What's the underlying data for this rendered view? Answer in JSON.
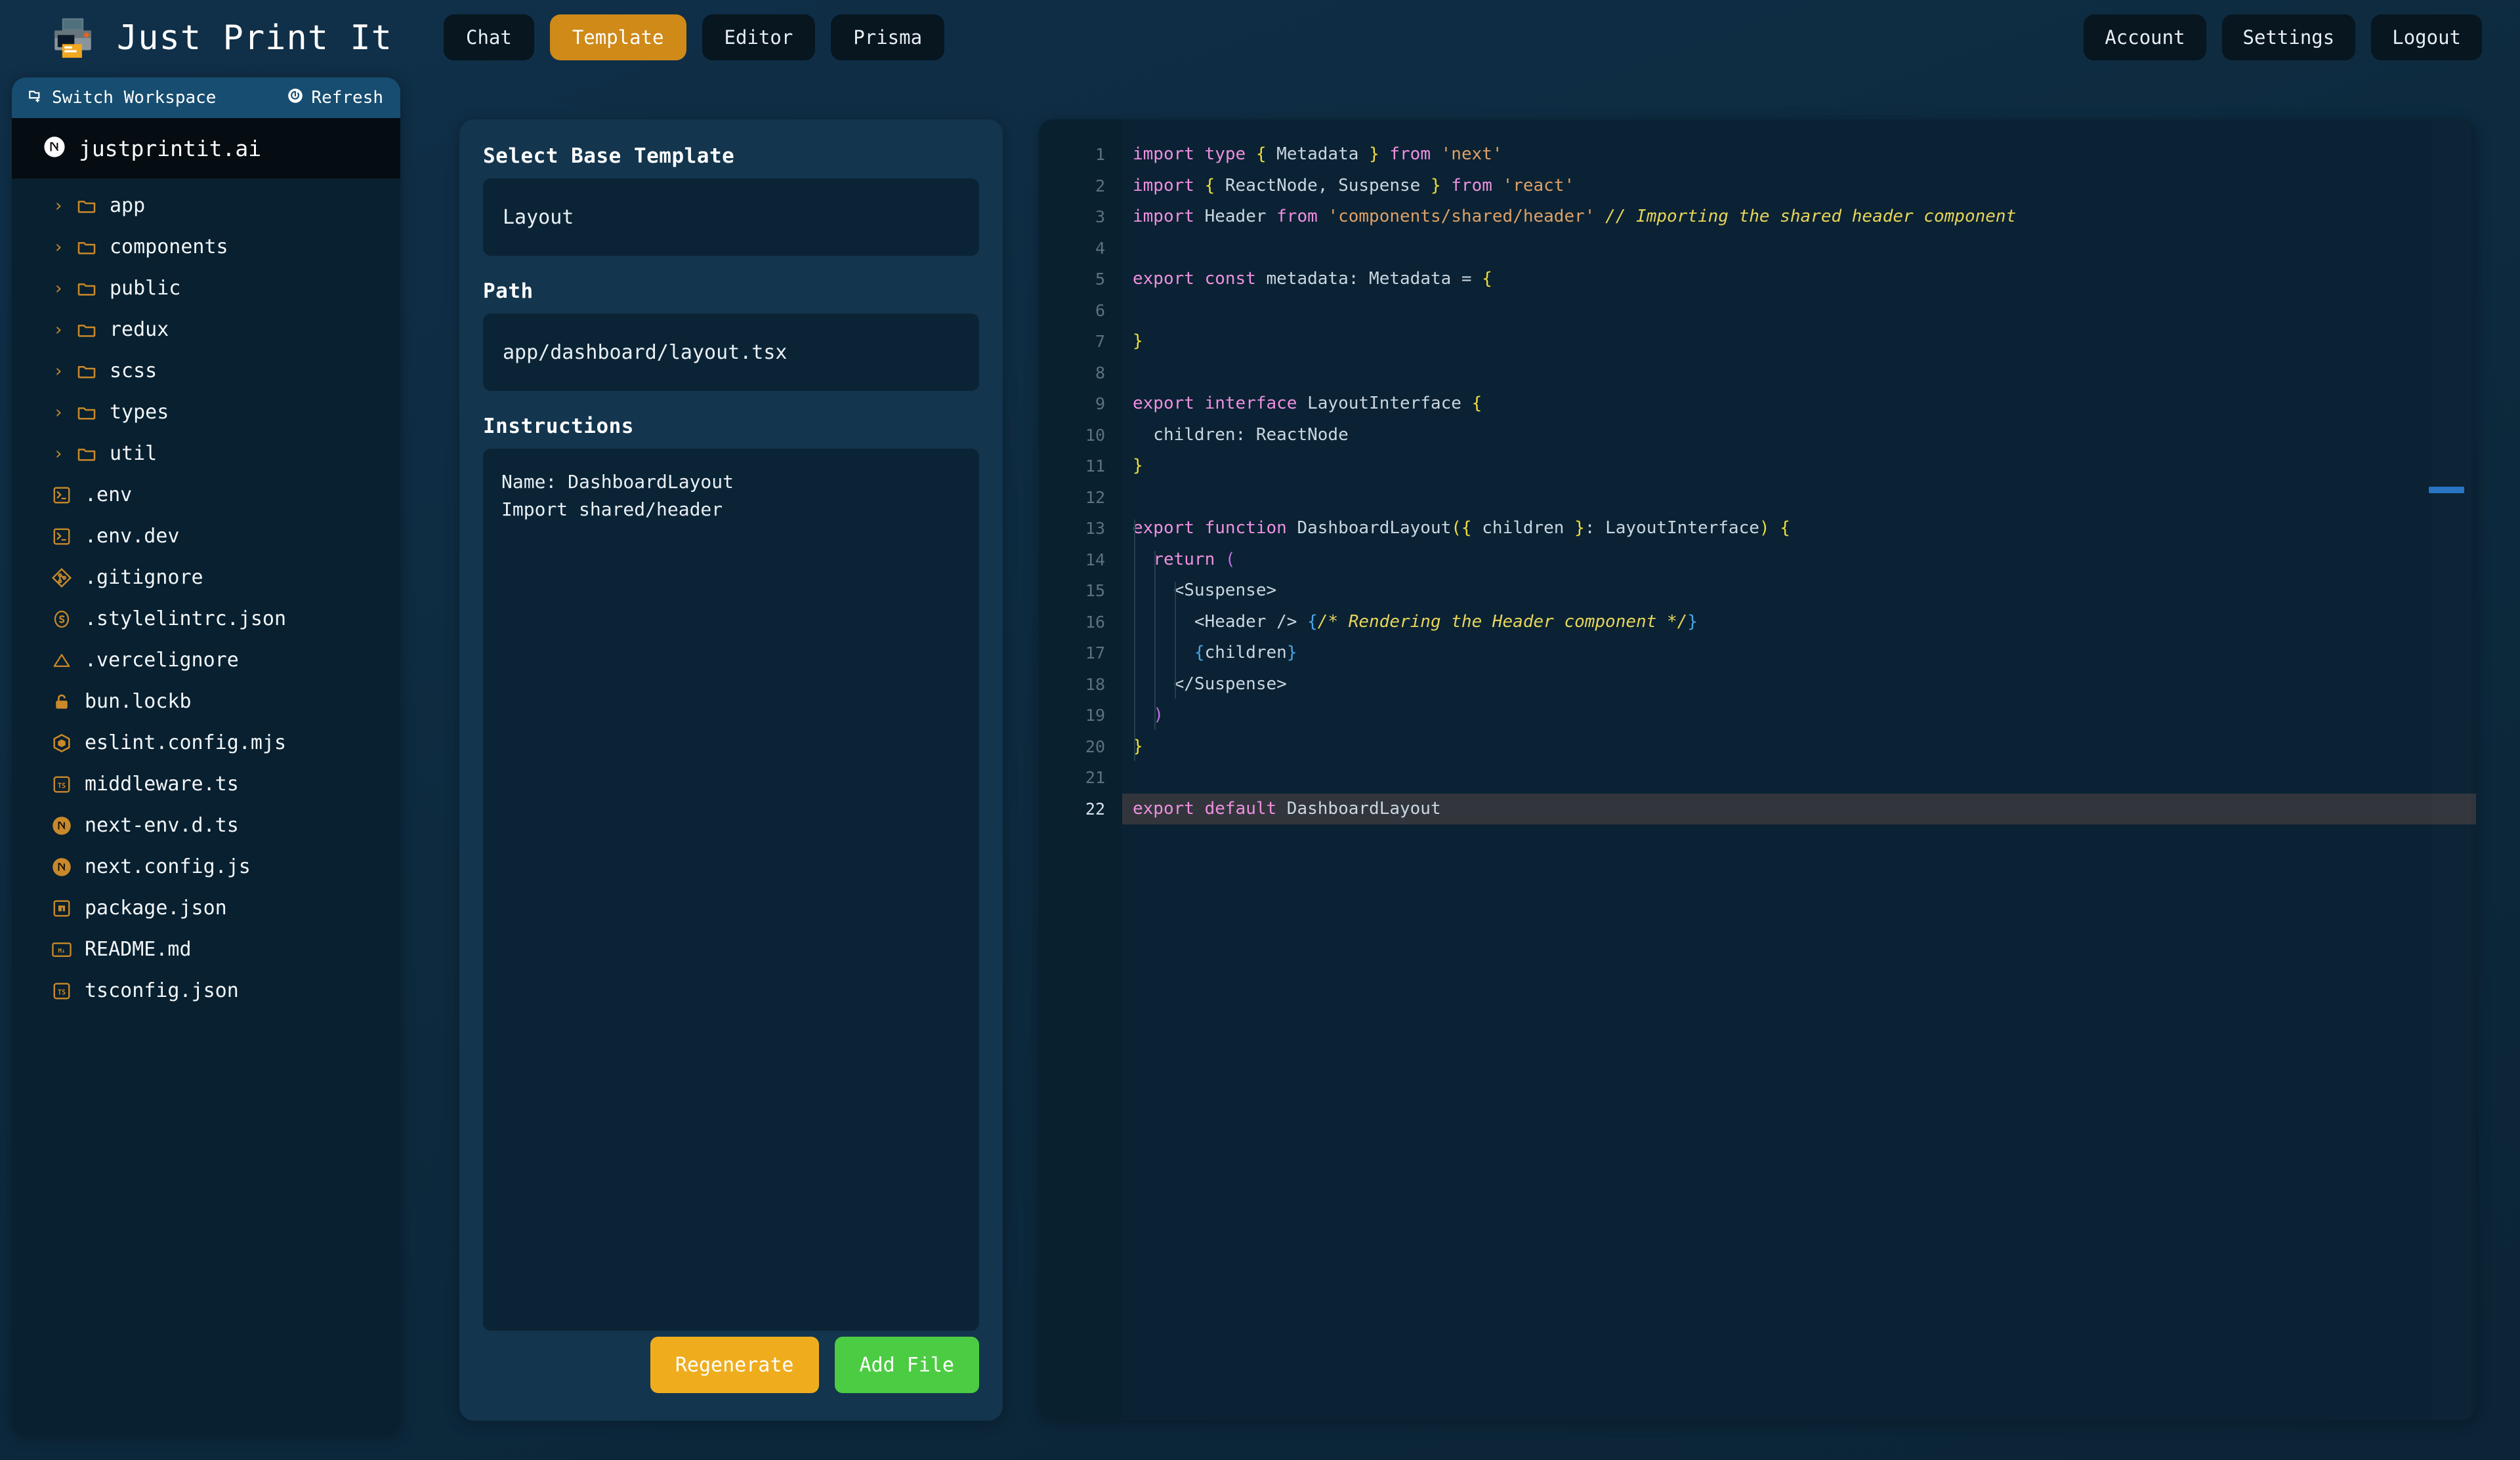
{
  "app": {
    "title": "Just Print It",
    "logo_icon": "printer-icon"
  },
  "tabs": [
    {
      "label": "Chat",
      "active": false
    },
    {
      "label": "Template",
      "active": true
    },
    {
      "label": "Editor",
      "active": false
    },
    {
      "label": "Prisma",
      "active": false
    }
  ],
  "nav_right": [
    {
      "label": "Account"
    },
    {
      "label": "Settings"
    },
    {
      "label": "Logout"
    }
  ],
  "sidebar": {
    "switch_workspace": "Switch Workspace",
    "switch_icon": "folder-plus-icon",
    "refresh": "Refresh",
    "refresh_icon": "refresh-icon",
    "workspace": {
      "name": "justprintit.ai",
      "icon": "nextjs-icon"
    },
    "tree": [
      {
        "label": "app",
        "type": "folder",
        "icon": "folder-icon",
        "expanded": false
      },
      {
        "label": "components",
        "type": "folder",
        "icon": "folder-icon",
        "expanded": false
      },
      {
        "label": "public",
        "type": "folder",
        "icon": "folder-icon",
        "expanded": false
      },
      {
        "label": "redux",
        "type": "folder",
        "icon": "folder-icon",
        "expanded": false
      },
      {
        "label": "scss",
        "type": "folder",
        "icon": "folder-icon",
        "expanded": false
      },
      {
        "label": "types",
        "type": "folder",
        "icon": "folder-icon",
        "expanded": false
      },
      {
        "label": "util",
        "type": "folder",
        "icon": "folder-icon",
        "expanded": false
      },
      {
        "label": ".env",
        "type": "file",
        "icon": "console-icon"
      },
      {
        "label": ".env.dev",
        "type": "file",
        "icon": "console-icon"
      },
      {
        "label": ".gitignore",
        "type": "file",
        "icon": "git-icon"
      },
      {
        "label": ".stylelintrc.json",
        "type": "file",
        "icon": "stylelint-icon"
      },
      {
        "label": ".vercelignore",
        "type": "file",
        "icon": "vercel-icon"
      },
      {
        "label": "bun.lockb",
        "type": "file",
        "icon": "lock-icon"
      },
      {
        "label": "eslint.config.mjs",
        "type": "file",
        "icon": "eslint-icon"
      },
      {
        "label": "middleware.ts",
        "type": "file",
        "icon": "typescript-icon"
      },
      {
        "label": "next-env.d.ts",
        "type": "file",
        "icon": "nextjs-icon"
      },
      {
        "label": "next.config.js",
        "type": "file",
        "icon": "nextjs-icon"
      },
      {
        "label": "package.json",
        "type": "file",
        "icon": "npm-icon"
      },
      {
        "label": "README.md",
        "type": "file",
        "icon": "markdown-icon"
      },
      {
        "label": "tsconfig.json",
        "type": "file",
        "icon": "typescript-icon"
      }
    ]
  },
  "form": {
    "base_template_label": "Select Base Template",
    "base_template_value": "Layout",
    "path_label": "Path",
    "path_value": "app/dashboard/layout.tsx",
    "instructions_label": "Instructions",
    "instructions_value": "Name: DashboardLayout\nImport shared/header",
    "regenerate_label": "Regenerate",
    "add_file_label": "Add File"
  },
  "colors": {
    "accent_orange": "#cf8a18",
    "regenerate": "#efad1d",
    "add_file": "#4ccc42",
    "panel": "#13354e",
    "sidebar": "#08202f",
    "code_bg": "#0a2233",
    "workspace_header": "#174d70"
  },
  "editor": {
    "active_line": 22,
    "total_lines": 22,
    "lines": [
      {
        "n": 1,
        "tokens": [
          {
            "t": "import",
            "c": "k"
          },
          {
            "t": " ",
            "c": "t"
          },
          {
            "t": "type",
            "c": "k"
          },
          {
            "t": " ",
            "c": "t"
          },
          {
            "t": "{",
            "c": "y"
          },
          {
            "t": " Metadata ",
            "c": "t"
          },
          {
            "t": "}",
            "c": "y"
          },
          {
            "t": " ",
            "c": "t"
          },
          {
            "t": "from",
            "c": "k"
          },
          {
            "t": " ",
            "c": "t"
          },
          {
            "t": "'next'",
            "c": "s"
          }
        ]
      },
      {
        "n": 2,
        "tokens": [
          {
            "t": "import",
            "c": "k"
          },
          {
            "t": " ",
            "c": "t"
          },
          {
            "t": "{",
            "c": "y"
          },
          {
            "t": " ReactNode, Suspense ",
            "c": "t"
          },
          {
            "t": "}",
            "c": "y"
          },
          {
            "t": " ",
            "c": "t"
          },
          {
            "t": "from",
            "c": "k"
          },
          {
            "t": " ",
            "c": "t"
          },
          {
            "t": "'react'",
            "c": "s"
          }
        ]
      },
      {
        "n": 3,
        "tokens": [
          {
            "t": "import",
            "c": "k"
          },
          {
            "t": " Header ",
            "c": "t"
          },
          {
            "t": "from",
            "c": "k"
          },
          {
            "t": " ",
            "c": "t"
          },
          {
            "t": "'components/shared/header'",
            "c": "s"
          },
          {
            "t": " ",
            "c": "t"
          },
          {
            "t": "// Importing the shared header component",
            "c": "c"
          }
        ]
      },
      {
        "n": 4,
        "tokens": []
      },
      {
        "n": 5,
        "tokens": [
          {
            "t": "export",
            "c": "k"
          },
          {
            "t": " ",
            "c": "t"
          },
          {
            "t": "const",
            "c": "k"
          },
          {
            "t": " metadata: Metadata = ",
            "c": "t"
          },
          {
            "t": "{",
            "c": "y"
          }
        ]
      },
      {
        "n": 6,
        "tokens": []
      },
      {
        "n": 7,
        "tokens": [
          {
            "t": "}",
            "c": "y"
          }
        ]
      },
      {
        "n": 8,
        "tokens": []
      },
      {
        "n": 9,
        "tokens": [
          {
            "t": "export",
            "c": "k"
          },
          {
            "t": " ",
            "c": "t"
          },
          {
            "t": "interface",
            "c": "k"
          },
          {
            "t": " LayoutInterface ",
            "c": "t"
          },
          {
            "t": "{",
            "c": "y"
          }
        ]
      },
      {
        "n": 10,
        "tokens": [
          {
            "t": "  children: ReactNode",
            "c": "t"
          }
        ]
      },
      {
        "n": 11,
        "tokens": [
          {
            "t": "}",
            "c": "y"
          }
        ]
      },
      {
        "n": 12,
        "tokens": []
      },
      {
        "n": 13,
        "tokens": [
          {
            "t": "export",
            "c": "k"
          },
          {
            "t": " ",
            "c": "t"
          },
          {
            "t": "function",
            "c": "k"
          },
          {
            "t": " DashboardLayout",
            "c": "t"
          },
          {
            "t": "(",
            "c": "y"
          },
          {
            "t": "{",
            "c": "y"
          },
          {
            "t": " children ",
            "c": "t"
          },
          {
            "t": "}",
            "c": "y"
          },
          {
            "t": ": LayoutInterface",
            "c": "t"
          },
          {
            "t": ")",
            "c": "y"
          },
          {
            "t": " ",
            "c": "t"
          },
          {
            "t": "{",
            "c": "y"
          }
        ]
      },
      {
        "n": 14,
        "tokens": [
          {
            "t": "  ",
            "c": "t"
          },
          {
            "t": "return",
            "c": "k"
          },
          {
            "t": " ",
            "c": "t"
          },
          {
            "t": "(",
            "c": "m"
          }
        ]
      },
      {
        "n": 15,
        "tokens": [
          {
            "t": "    <Suspense>",
            "c": "t"
          }
        ]
      },
      {
        "n": 16,
        "tokens": [
          {
            "t": "      <Header /> ",
            "c": "t"
          },
          {
            "t": "{",
            "c": "b"
          },
          {
            "t": "/* Rendering the Header component */",
            "c": "c"
          },
          {
            "t": "}",
            "c": "b"
          }
        ]
      },
      {
        "n": 17,
        "tokens": [
          {
            "t": "      ",
            "c": "t"
          },
          {
            "t": "{",
            "c": "b"
          },
          {
            "t": "children",
            "c": "t"
          },
          {
            "t": "}",
            "c": "b"
          }
        ]
      },
      {
        "n": 18,
        "tokens": [
          {
            "t": "    </Suspense>",
            "c": "t"
          }
        ]
      },
      {
        "n": 19,
        "tokens": [
          {
            "t": "  ",
            "c": "t"
          },
          {
            "t": ")",
            "c": "m"
          }
        ]
      },
      {
        "n": 20,
        "tokens": [
          {
            "t": "}",
            "c": "y"
          }
        ]
      },
      {
        "n": 21,
        "tokens": []
      },
      {
        "n": 22,
        "tokens": [
          {
            "t": "export",
            "c": "k"
          },
          {
            "t": " ",
            "c": "t"
          },
          {
            "t": "default",
            "c": "k"
          },
          {
            "t": " DashboardLayout",
            "c": "t"
          }
        ]
      }
    ]
  }
}
